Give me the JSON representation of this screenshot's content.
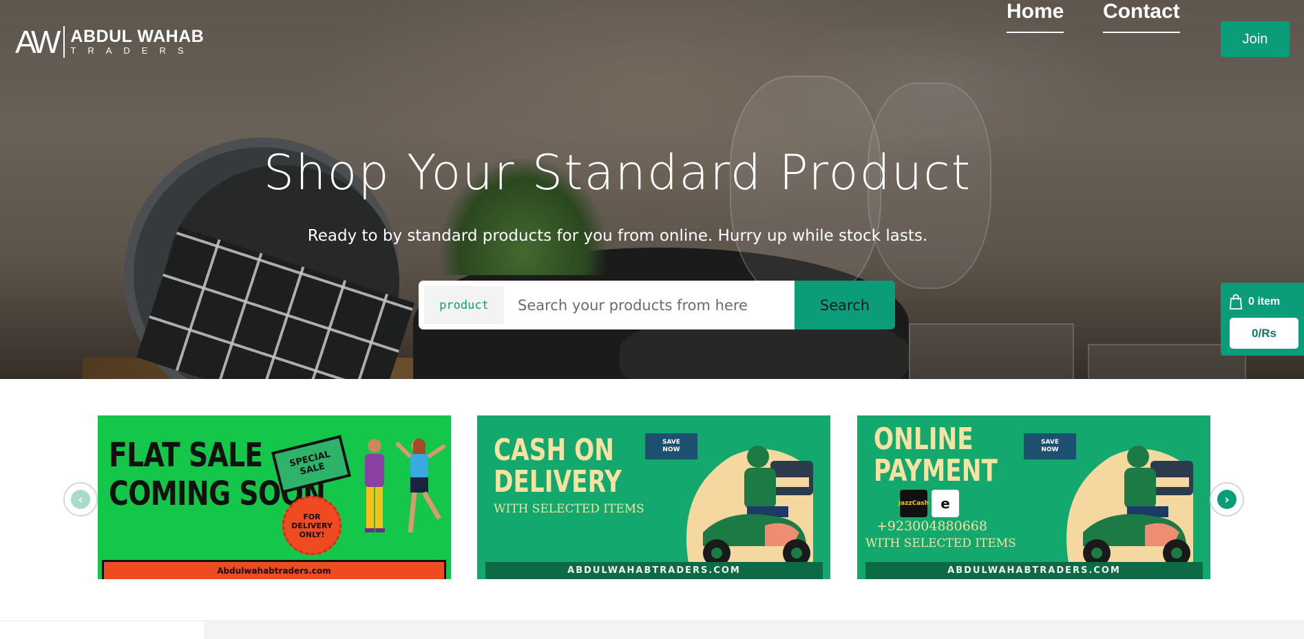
{
  "logo": {
    "mark": "AW",
    "name": "ABDUL WAHAB",
    "subtitle": "TRADERS"
  },
  "nav": {
    "home": "Home",
    "contact": "Contact",
    "join": "Join"
  },
  "hero": {
    "title": "Shop Your Standard Product",
    "subtitle": "Ready to by standard products for you from online. Hurry up while stock lasts."
  },
  "search": {
    "category": "product",
    "placeholder": "Search your products from here",
    "value": "",
    "button": "Search"
  },
  "cart": {
    "icon": "shopping-bag-icon",
    "count": "0 item",
    "total": "0/Rs"
  },
  "carousel": {
    "prev_icon": "chevron-left-icon",
    "next_icon": "chevron-right-icon",
    "banners": [
      {
        "title_line1": "FLAT SALE",
        "title_line2": "COMING SOON",
        "sign_line1": "SPECIAL",
        "sign_line2": "SALE",
        "badge_line1": "FOR",
        "badge_line2": "DELIVERY",
        "badge_line3": "ONLY!",
        "footer": "Abdulwahabtraders.com"
      },
      {
        "title_line1": "CASH ON",
        "title_line2": "DELIVERY",
        "subtitle": "WITH SELECTED ITEMS",
        "sign_line1": "SAVE",
        "sign_line2": "NOW",
        "footer": "ABDULWAHABTRADERS.COM"
      },
      {
        "title_line1": "ONLINE",
        "title_line2": "PAYMENT",
        "wallet1": "JazzCash",
        "wallet2": "e",
        "phone": "+923004880668",
        "subtitle": "WITH SELECTED ITEMS",
        "sign_line1": "SAVE",
        "sign_line2": "NOW",
        "footer": "ABDULWAHABTRADERS.COM"
      }
    ]
  },
  "colors": {
    "accent": "#0b9d79",
    "banner_green": "#14c74b",
    "banner_teal": "#13a86d",
    "banner_orange": "#f04a23",
    "banner_cream": "#f6e3a1"
  }
}
